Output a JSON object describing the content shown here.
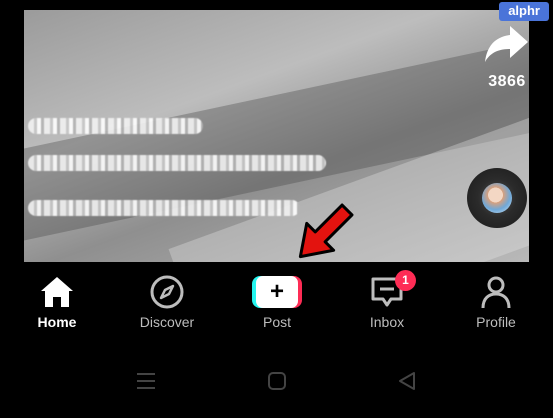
{
  "watermark": "alphr",
  "share": {
    "icon": "share-arrow-icon",
    "count": "3866"
  },
  "nav": {
    "items": [
      {
        "label": "Home",
        "icon": "home-icon",
        "active": true
      },
      {
        "label": "Discover",
        "icon": "compass-icon",
        "active": false
      },
      {
        "label": "Post",
        "icon": "plus-icon",
        "active": false
      },
      {
        "label": "Inbox",
        "icon": "message-icon",
        "active": false,
        "badge": "1"
      },
      {
        "label": "Profile",
        "icon": "person-icon",
        "active": false
      }
    ]
  },
  "colors": {
    "accent_red": "#fe2c55",
    "accent_cyan": "#25f4ee",
    "watermark_bg": "#4a74d9",
    "arrow_red": "#e3130f"
  },
  "system_nav": [
    "recents-icon",
    "home-square-icon",
    "back-triangle-icon"
  ]
}
